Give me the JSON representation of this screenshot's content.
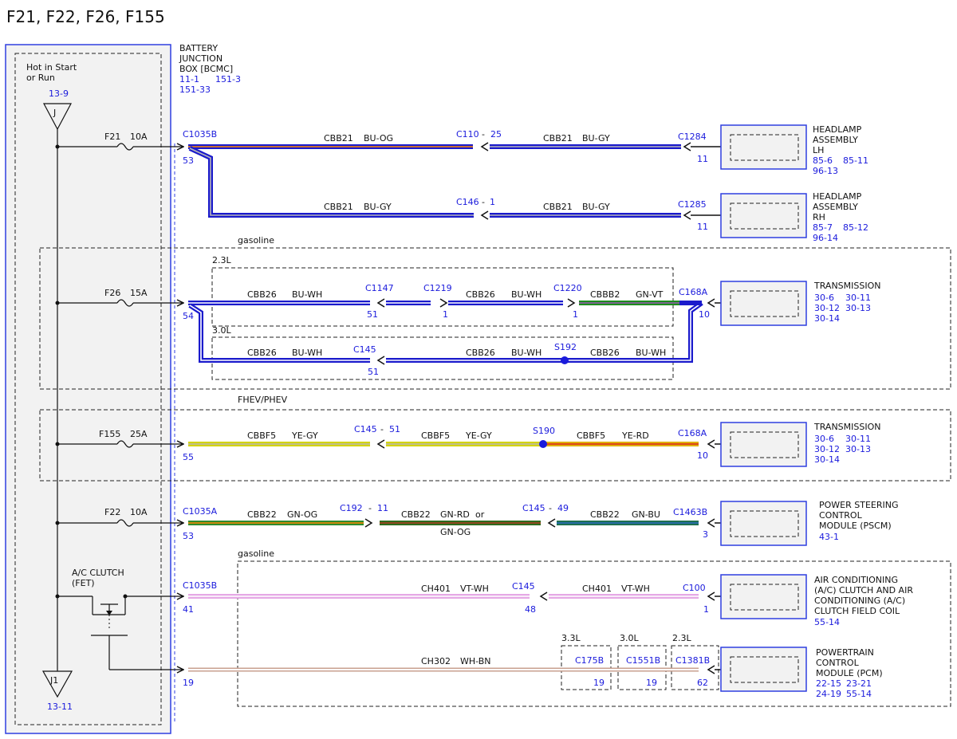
{
  "title": "F21, F22, F26, F155",
  "colors": {
    "link_blue": "#1a1adc",
    "panel_border": "#2f3fe0",
    "panel_fill": "#f2f2f2"
  },
  "bjb": {
    "name": [
      "BATTERY",
      "JUNCTION",
      "BOX [BCMC]"
    ],
    "refs": [
      "11-1",
      "151-3",
      "151-33"
    ]
  },
  "power": {
    "hot_label": [
      "Hot in Start",
      "or Run"
    ],
    "top_ref": "13-9",
    "top_tag": "J",
    "bottom_tag": "J1",
    "bottom_ref": "13-11"
  },
  "fuses": [
    {
      "id": "F21",
      "amps": "10A"
    },
    {
      "id": "F26",
      "amps": "15A"
    },
    {
      "id": "F155",
      "amps": "25A"
    },
    {
      "id": "F22",
      "amps": "10A"
    }
  ],
  "ac_clutch_label": [
    "A/C CLUTCH",
    "(FET)"
  ],
  "zones": {
    "gasoline": "gasoline",
    "hybrid": "FHEV/PHEV",
    "gasoline2": "gasoline",
    "eng23": "2.3L",
    "eng30": "3.0L"
  },
  "engine_tags": [
    "3.3L",
    "3.0L",
    "2.3L"
  ],
  "connectors": {
    "c1035b_1": "C1035B",
    "c1035b_1_pin": "53",
    "c26_pin": "54",
    "c155_pin": "55",
    "c1035a": "C1035A",
    "c1035a_pin": "53",
    "c1035b_2": "C1035B",
    "c1035b_2_pin": "41",
    "c1035b_3_pin": "19",
    "c110": "C110",
    "c110_pin": "25",
    "c146": "C146",
    "c146_pin": "1",
    "c1284": "C1284",
    "c1284_pin": "11",
    "c1285": "C1285",
    "c1285_pin": "11",
    "c1147": "C1147",
    "c1147_pin": "51",
    "c1219": "C1219",
    "c1219_pin": "1",
    "c1220": "C1220",
    "c1220_pin": "1",
    "c168a_1": "C168A",
    "c168a_1_pin": "10",
    "c145_1": "C145",
    "c145_1_pin": "51",
    "s192": "S192",
    "c145_2": "C145",
    "c145_2_pin": "51",
    "s190": "S190",
    "c168a_2": "C168A",
    "c168a_2_pin": "10",
    "c192": "C192",
    "c192_pin": "11",
    "c145_3": "C145",
    "c145_3_pin": "49",
    "c1463b": "C1463B",
    "c1463b_pin": "3",
    "c145_4": "C145",
    "c145_4_pin": "48",
    "c100": "C100",
    "c100_pin": "1",
    "c175b": "C175B",
    "c175b_pin": "19",
    "c1551b": "C1551B",
    "c1551b_pin": "19",
    "c1381b": "C1381B",
    "c1381b_pin": "62"
  },
  "wires": {
    "r1a": [
      "CBB21",
      "BU-OG"
    ],
    "r1b": [
      "CBB21",
      "BU-GY"
    ],
    "r2a": [
      "CBB21",
      "BU-GY"
    ],
    "r2b": [
      "CBB21",
      "BU-GY"
    ],
    "r3a": [
      "CBB26",
      "BU-WH"
    ],
    "r3b": [
      "CBB26",
      "BU-WH"
    ],
    "r3c": [
      "CBBB2",
      "GN-VT"
    ],
    "r4a": [
      "CBB26",
      "BU-WH"
    ],
    "r4b": [
      "CBB26",
      "BU-WH"
    ],
    "r4c": [
      "CBB26",
      "BU-WH"
    ],
    "r5a": [
      "CBBF5",
      "YE-GY"
    ],
    "r5b": [
      "CBBF5",
      "YE-GY"
    ],
    "r5c": [
      "CBBF5",
      "YE-RD"
    ],
    "r6a": [
      "CBB22",
      "GN-OG"
    ],
    "r6b": [
      "CBB22",
      "GN-RD",
      "or",
      "GN-OG"
    ],
    "r6c": [
      "CBB22",
      "GN-BU"
    ],
    "r7a": [
      "CH401",
      "VT-WH"
    ],
    "r7b": [
      "CH401",
      "VT-WH"
    ],
    "r8": [
      "CH302",
      "WH-BN"
    ]
  },
  "components": [
    {
      "name": [
        "HEADLAMP",
        "ASSEMBLY",
        "LH"
      ],
      "refs": [
        "85-6",
        "85-11",
        "96-13"
      ]
    },
    {
      "name": [
        "HEADLAMP",
        "ASSEMBLY",
        "RH"
      ],
      "refs": [
        "85-7",
        "85-12",
        "96-14"
      ]
    },
    {
      "name": [
        "TRANSMISSION"
      ],
      "refs": [
        "30-6",
        "30-11",
        "30-12",
        "30-13",
        "30-14"
      ]
    },
    {
      "name": [
        "TRANSMISSION"
      ],
      "refs": [
        "30-6",
        "30-11",
        "30-12",
        "30-13",
        "30-14"
      ]
    },
    {
      "name": [
        "POWER STEERING",
        "CONTROL",
        "MODULE (PSCM)"
      ],
      "refs": [
        "43-1"
      ]
    },
    {
      "name": [
        "AIR CONDITIONING",
        "(A/C) CLUTCH AND AIR",
        "CONDITIONING (A/C)",
        "CLUTCH FIELD COIL"
      ],
      "refs": [
        "55-14"
      ]
    },
    {
      "name": [
        "POWERTRAIN",
        "CONTROL",
        "MODULE (PCM)"
      ],
      "refs": [
        "22-15",
        "23-21",
        "24-19",
        "55-14"
      ]
    }
  ]
}
